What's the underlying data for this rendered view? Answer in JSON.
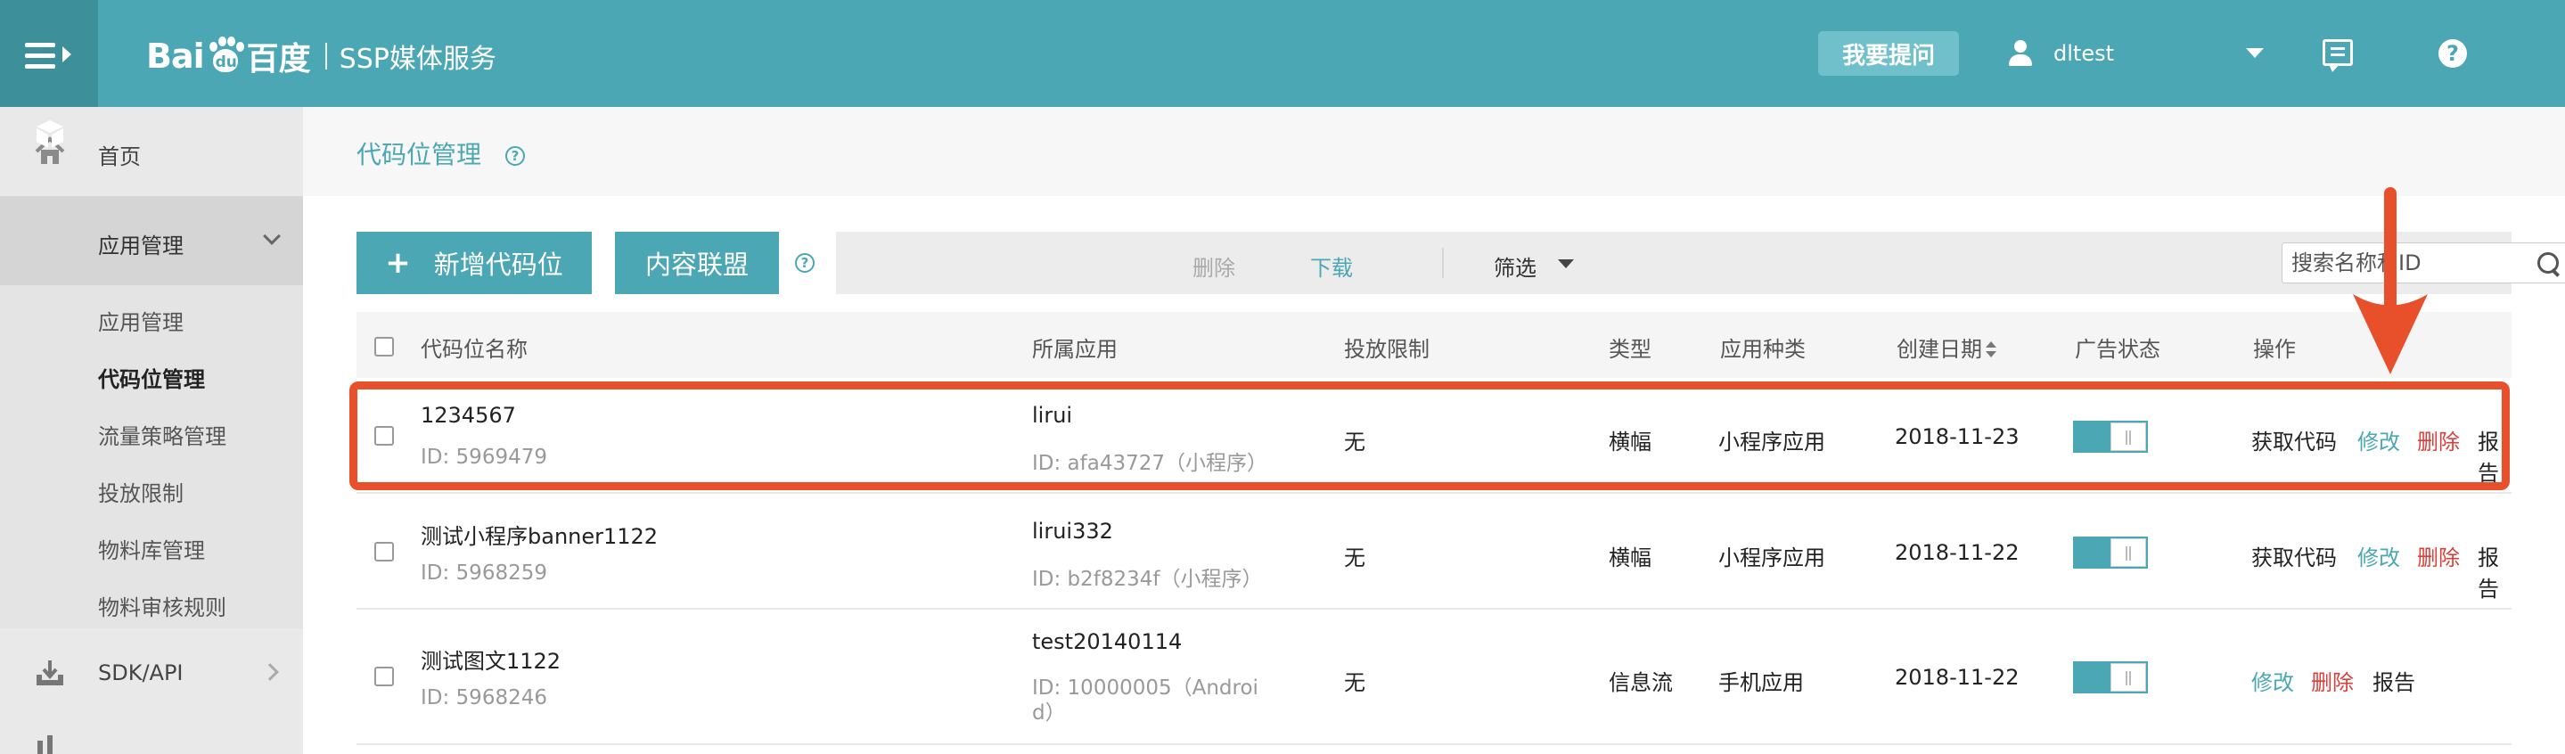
{
  "header": {
    "logo_bai": "Bai",
    "logo_du": "du",
    "logo_cn": "百度",
    "product": "SSP媒体服务",
    "ask_button": "我要提问",
    "username": "dltest",
    "help": "?"
  },
  "sidebar": {
    "home": "首页",
    "app_mgmt": "应用管理",
    "sub_items": [
      "应用管理",
      "代码位管理",
      "流量策略管理",
      "投放限制",
      "物料库管理",
      "物料审核规则"
    ],
    "sdk_api": "SDK/API"
  },
  "page": {
    "title": "代码位管理",
    "help": "?"
  },
  "toolbar": {
    "new_button": "新增代码位",
    "union_button": "内容联盟",
    "help": "?",
    "delete": "删除",
    "download": "下载",
    "filter": "筛选",
    "search_placeholder": "搜索名称和ID"
  },
  "table": {
    "columns": [
      "代码位名称",
      "所属应用",
      "投放限制",
      "类型",
      "应用种类",
      "创建日期",
      "广告状态",
      "操作"
    ],
    "rows": [
      {
        "name": "1234567",
        "id": "ID: 5969479",
        "app": "lirui",
        "app_id": "ID: afa43727（小程序）",
        "limit": "无",
        "type": "横幅",
        "app_kind": "小程序应用",
        "date": "2018-11-23",
        "status_on": true,
        "ops": [
          "获取代码",
          "修改",
          "删除",
          "报告"
        ]
      },
      {
        "name": "测试小程序banner1122",
        "id": "ID: 5968259",
        "app": "lirui332",
        "app_id": "ID: b2f8234f（小程序）",
        "limit": "无",
        "type": "横幅",
        "app_kind": "小程序应用",
        "date": "2018-11-22",
        "status_on": true,
        "ops": [
          "获取代码",
          "修改",
          "删除",
          "报告"
        ]
      },
      {
        "name": "测试图文1122",
        "id": "ID: 5968246",
        "app": "test20140114",
        "app_id_line1": "ID: 10000005（Androi",
        "app_id_line2": "d）",
        "limit": "无",
        "type": "信息流",
        "app_kind": "手机应用",
        "date": "2018-11-22",
        "status_on": true,
        "ops": [
          "修改",
          "删除",
          "报告"
        ]
      }
    ]
  },
  "colors": {
    "header": "#4ba7b3",
    "accent": "#4ba7b3",
    "danger": "#d9403a",
    "annotation": "#e8502c"
  }
}
